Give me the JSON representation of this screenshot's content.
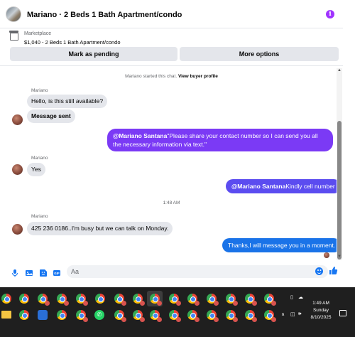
{
  "header": {
    "title": "Mariano · 2 Beds 1 Bath Apartment/condo",
    "info_icon": "info-icon",
    "accent": "#a033ff"
  },
  "listing": {
    "label": "Marketplace",
    "item": "$1,040 - 2 Beds 1 Bath Apartment/condo",
    "mark_pending": "Mark as pending",
    "more_options": "More options"
  },
  "thread": {
    "system_text": "Mariano started this chat.",
    "system_link": "View buyer profile",
    "time_divider": "1:48 AM",
    "messages": [
      {
        "from": "Mariano",
        "sender_label": "Mariano",
        "text": "Hello, is this still available?"
      },
      {
        "from": "Mariano",
        "text": "Message sent"
      },
      {
        "from": "me",
        "mention": "@Mariano Santana",
        "text": "\"Please share your contact number so I can send you all the necessary information via text.\""
      },
      {
        "from": "Mariano",
        "sender_label": "Mariano",
        "text": "Yes"
      },
      {
        "from": "me",
        "mention": "@Mariano Santana",
        "text": "Kindly cell number"
      },
      {
        "from": "Mariano",
        "sender_label": "Mariano",
        "text": "425 236 0186..I'm busy but we can talk on Monday."
      },
      {
        "from": "me",
        "text": "Thanks,I will message you in a moment."
      }
    ],
    "outgoing_colors": [
      "#7b3af5",
      "#5b4cf0",
      "#1a73e8"
    ]
  },
  "composer": {
    "placeholder": "Aa",
    "icons": [
      "microphone-icon",
      "photo-icon",
      "sticker-icon",
      "gif-icon",
      "emoji-icon",
      "thumbs-up-icon"
    ]
  },
  "taskbar": {
    "time": "1:49 AM",
    "day": "Sunday",
    "date": "8/10/2025"
  }
}
